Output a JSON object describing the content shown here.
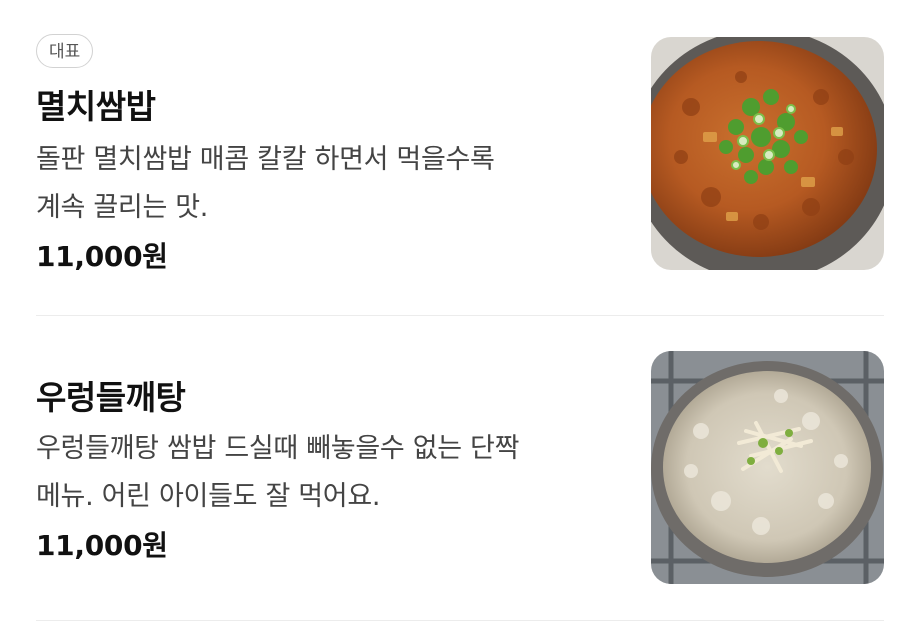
{
  "menu": {
    "items": [
      {
        "badge": "대표",
        "name": "멸치쌈밥",
        "description_lines": [
          "돌판 멸치쌈밥 매콤 칼칼 하면서 먹을수록",
          "계속 끌리는 맛."
        ],
        "price": "11,000원",
        "photo_icon": "anchovy-stew-photo"
      },
      {
        "name": "우렁들깨탕",
        "description_lines": [
          "우렁들깨탕 쌈밥 드실때 빼놓을수 없는 단짝",
          "메뉴. 어린 아이들도 잘 먹어요."
        ],
        "price": "11,000원",
        "photo_icon": "perilla-soup-photo"
      }
    ]
  },
  "colors": {
    "badge_border": "#d2d2d2",
    "divider": "#ececec",
    "text_primary": "#111111",
    "text_secondary": "#444444"
  }
}
